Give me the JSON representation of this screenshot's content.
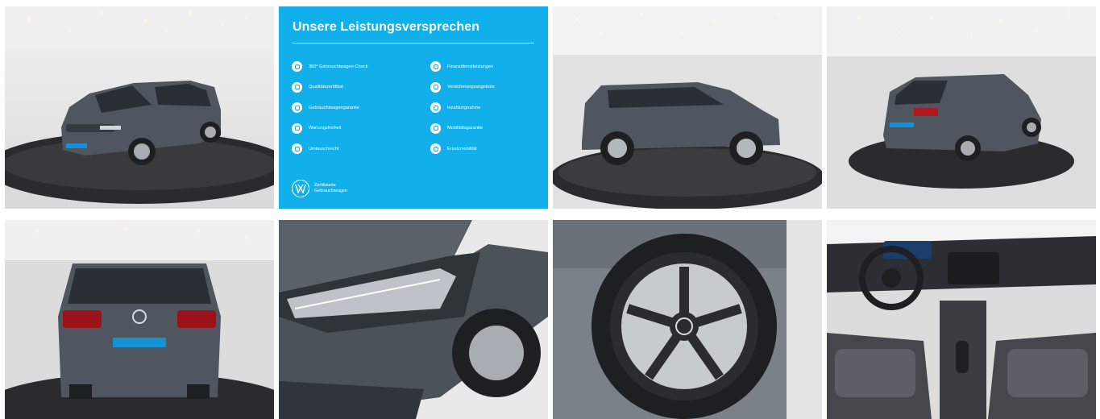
{
  "gallery": {
    "tiles": [
      {
        "name": "photo-front-three-quarter",
        "alt": "Front three-quarter view in showroom"
      },
      {
        "name": "service-promise-panel"
      },
      {
        "name": "photo-side-profile",
        "alt": "Side profile on turntable"
      },
      {
        "name": "photo-rear-three-quarter",
        "alt": "Rear three-quarter view"
      },
      {
        "name": "photo-rear",
        "alt": "Rear view"
      },
      {
        "name": "photo-headlight-detail",
        "alt": "Headlight detail"
      },
      {
        "name": "photo-wheel-detail",
        "alt": "Alloy wheel detail"
      },
      {
        "name": "photo-interior-dashboard",
        "alt": "Interior dashboard"
      }
    ]
  },
  "promise": {
    "title": "Unsere Leistungsversprechen",
    "left_items": [
      {
        "label": "360° Gebrauchtwagen-Check",
        "icon": "check-icon"
      },
      {
        "label": "Qualitätszertifikat",
        "icon": "certificate-icon"
      },
      {
        "label": "Gebrauchtwagengarantie",
        "icon": "shield-icon"
      },
      {
        "label": "Wartungsfreiheit",
        "icon": "wrench-icon"
      },
      {
        "label": "Umtauschrecht",
        "icon": "swap-icon"
      }
    ],
    "right_items": [
      {
        "label": "Finanzdienstleistungen",
        "icon": "finance-icon"
      },
      {
        "label": "Versicherungsangebote",
        "icon": "insurance-icon"
      },
      {
        "label": "Inzahlungnahme",
        "icon": "trade-in-icon"
      },
      {
        "label": "Mobilitätsgarantie",
        "icon": "mobility-icon"
      },
      {
        "label": "Ersatzmobilität",
        "icon": "replacement-car-icon"
      }
    ],
    "cert_line1": "Zertifizierte",
    "cert_line2": "Gebrauchtwagen",
    "brand_color": "#12b0ea"
  },
  "car_color": "#4f565f"
}
